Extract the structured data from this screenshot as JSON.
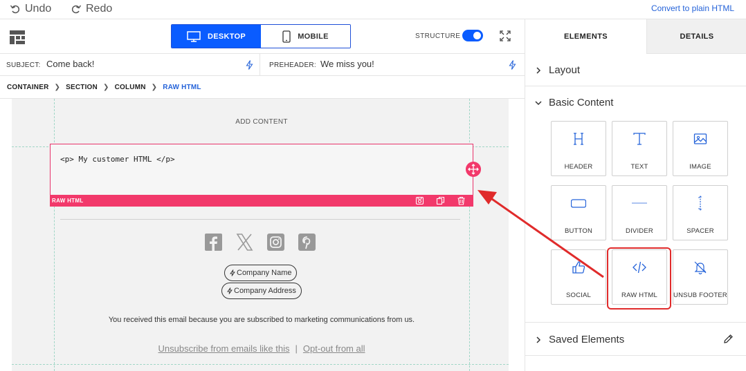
{
  "topbar": {
    "undo_label": "Undo",
    "redo_label": "Redo",
    "convert_label": "Convert to plain HTML"
  },
  "toolbar": {
    "desktop_label": "DESKTOP",
    "mobile_label": "MOBILE",
    "structure_label": "STRUCTURE",
    "structure_on": true
  },
  "fields": {
    "subject_label": "SUBJECT:",
    "subject_value": "Come back!",
    "preheader_label": "PREHEADER:",
    "preheader_value": "We miss you!"
  },
  "breadcrumb": {
    "items": [
      "CONTAINER",
      "SECTION",
      "COLUMN"
    ],
    "current": "RAW HTML",
    "separator": "❯"
  },
  "canvas": {
    "add_content": "ADD CONTENT",
    "raw_code": "<p> My customer HTML </p>",
    "raw_bar_label": "RAW HTML",
    "social_icons": [
      "facebook-icon",
      "x-icon",
      "instagram-icon",
      "pinterest-icon"
    ],
    "company_name": "Company Name",
    "company_address": "Company Address",
    "notice": "You received this email because you are subscribed to marketing communications from us.",
    "unsubscribe_link": "Unsubscribe from emails like this",
    "optout_link": "Opt-out from all",
    "link_separator": "|"
  },
  "panel": {
    "tab_elements": "ELEMENTS",
    "tab_details": "DETAILS",
    "layout_section": "Layout",
    "basic_section": "Basic Content",
    "saved_section": "Saved Elements",
    "tiles": [
      {
        "label": "HEADER",
        "icon": "header-icon"
      },
      {
        "label": "TEXT",
        "icon": "text-icon"
      },
      {
        "label": "IMAGE",
        "icon": "image-icon"
      },
      {
        "label": "BUTTON",
        "icon": "button-icon"
      },
      {
        "label": "DIVIDER",
        "icon": "divider-icon"
      },
      {
        "label": "SPACER",
        "icon": "spacer-icon"
      },
      {
        "label": "SOCIAL",
        "icon": "thumbs-up-icon"
      },
      {
        "label": "RAW HTML",
        "icon": "code-icon"
      },
      {
        "label": "UNSUB FOOTER",
        "icon": "bell-off-icon"
      }
    ]
  },
  "colors": {
    "accent": "#0a5cff",
    "link": "#2563d9",
    "raw_highlight": "#f2396b",
    "annotation": "#e02b2b",
    "guide": "#9fd6c6"
  }
}
